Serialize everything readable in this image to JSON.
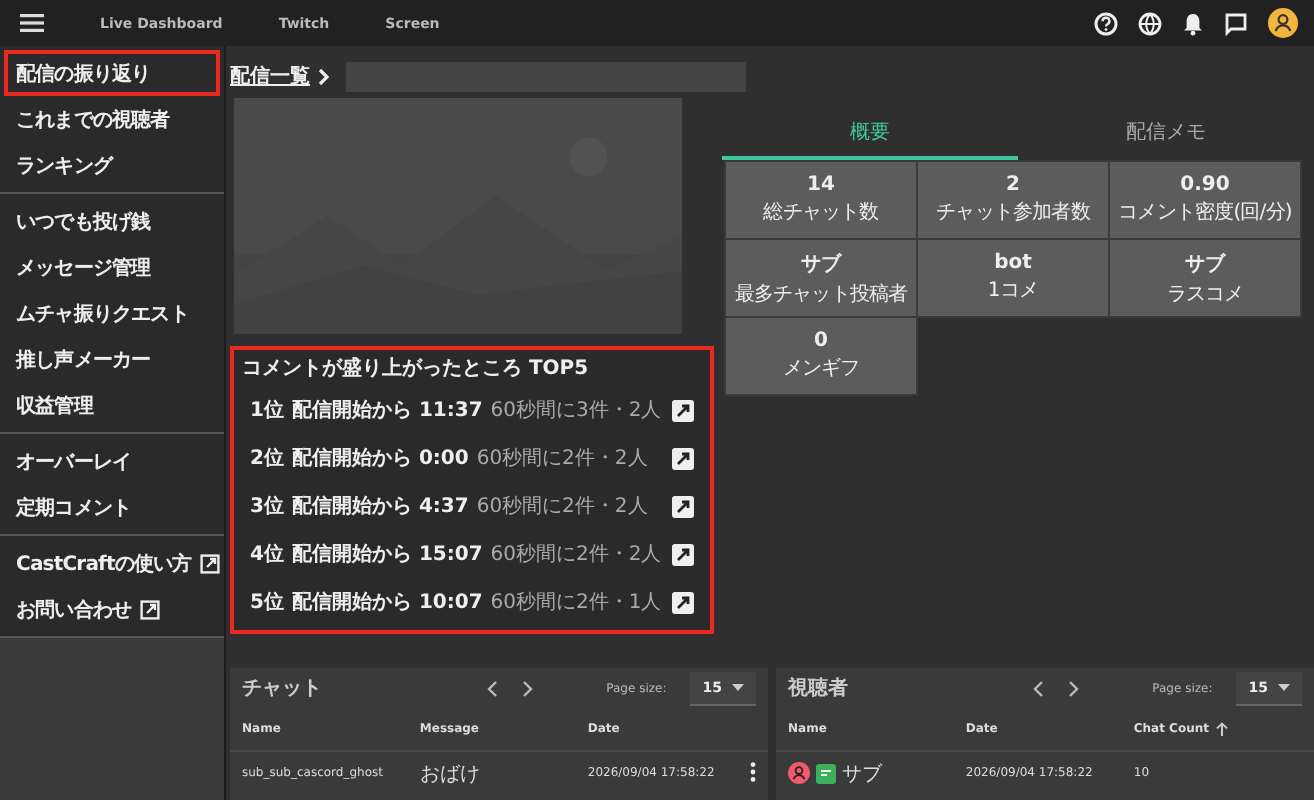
{
  "top_bar": {
    "nav": [
      {
        "label": "Live Dashboard"
      },
      {
        "label": "Twitch"
      },
      {
        "label": "Screen"
      }
    ]
  },
  "sidebar": {
    "groups": [
      [
        {
          "label": "配信の振り返り",
          "highlighted": true,
          "external": false
        },
        {
          "label": "これまでの視聴者",
          "highlighted": false,
          "external": false
        },
        {
          "label": "ランキング",
          "highlighted": false,
          "external": false
        }
      ],
      [
        {
          "label": "いつでも投げ銭",
          "highlighted": false,
          "external": false
        },
        {
          "label": "メッセージ管理",
          "highlighted": false,
          "external": false
        },
        {
          "label": "ムチャ振りクエスト",
          "highlighted": false,
          "external": false
        },
        {
          "label": "推し声メーカー",
          "highlighted": false,
          "external": false
        },
        {
          "label": "収益管理",
          "highlighted": false,
          "external": false
        }
      ],
      [
        {
          "label": "オーバーレイ",
          "highlighted": false,
          "external": false
        },
        {
          "label": "定期コメント",
          "highlighted": false,
          "external": false
        }
      ],
      [
        {
          "label": "CastCraftの使い方",
          "highlighted": false,
          "external": true
        },
        {
          "label": "お問い合わせ",
          "highlighted": false,
          "external": true
        }
      ]
    ]
  },
  "breadcrumb": {
    "title": "配信一覧"
  },
  "tabs": [
    {
      "label": "概要",
      "selected": true
    },
    {
      "label": "配信メモ",
      "selected": false
    }
  ],
  "stats": [
    {
      "value": "14",
      "label": "総チャット数"
    },
    {
      "value": "2",
      "label": "チャット参加者数"
    },
    {
      "value": "0.90",
      "label": "コメント密度(回/分)"
    },
    {
      "value": "サブ",
      "label": "最多チャット投稿者"
    },
    {
      "value": "bot",
      "label": "1コメ"
    },
    {
      "value": "サブ",
      "label": "ラスコメ"
    },
    {
      "value": "0",
      "label": "メンギフ"
    }
  ],
  "top5": {
    "title": "コメントが盛り上がったところ TOP5",
    "highlighted": true,
    "rows": [
      {
        "rank": "1位",
        "time": "配信開始から 11:37",
        "detail": "60秒間に3件・2人"
      },
      {
        "rank": "2位",
        "time": "配信開始から 0:00",
        "detail": "60秒間に2件・2人"
      },
      {
        "rank": "3位",
        "time": "配信開始から 4:37",
        "detail": "60秒間に2件・2人"
      },
      {
        "rank": "4位",
        "time": "配信開始から 15:07",
        "detail": "60秒間に2件・2人"
      },
      {
        "rank": "5位",
        "time": "配信開始から 10:07",
        "detail": "60秒間に2件・1人"
      }
    ]
  },
  "chat_table": {
    "title": "チャット",
    "page_size_label": "Page size:",
    "page_size": "15",
    "columns": [
      {
        "label": "Name",
        "sorted": false
      },
      {
        "label": "Message",
        "sorted": false
      },
      {
        "label": "Date",
        "sorted": false
      }
    ],
    "rows": [
      {
        "cells": [
          "sub_sub_cascord_ghost",
          "おばけ",
          "2026/09/04 17:58:22"
        ]
      }
    ]
  },
  "viewer_table": {
    "title": "視聴者",
    "page_size_label": "Page size:",
    "page_size": "15",
    "columns": [
      {
        "label": "Name",
        "sorted": false
      },
      {
        "label": "Date",
        "sorted": false
      },
      {
        "label": "Chat Count",
        "sorted": true
      }
    ],
    "rows": [
      {
        "name": "サブ",
        "date": "2026/09/04 17:58:22",
        "chat_count": "10"
      }
    ]
  }
}
